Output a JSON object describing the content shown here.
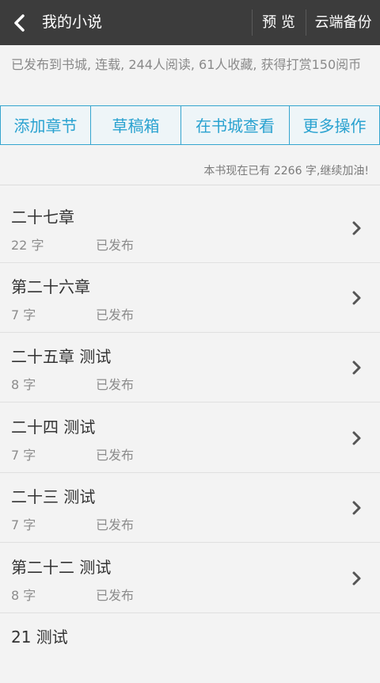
{
  "header": {
    "title": "我的小说",
    "preview_label": "预 览",
    "backup_label": "云端备份"
  },
  "info": {
    "summary": "已发布到书城, 连载, 244人阅读, 61人收藏, 获得打赏150阅币"
  },
  "actions": [
    {
      "label": "添加章节"
    },
    {
      "label": "草稿箱"
    },
    {
      "label": "在书城查看"
    },
    {
      "label": "更多操作"
    }
  ],
  "notice": "本书现在已有 2266 字,继续加油!",
  "chapters": [
    {
      "name": "二十七章",
      "count": "22 字",
      "status": "已发布"
    },
    {
      "name": "第二十六章",
      "count": "7 字",
      "status": "已发布"
    },
    {
      "name": "二十五章 测试",
      "count": "8 字",
      "status": "已发布"
    },
    {
      "name": "二十四 测试",
      "count": "7 字",
      "status": "已发布"
    },
    {
      "name": "二十三 测试",
      "count": "7 字",
      "status": "已发布"
    },
    {
      "name": "第二十二 测试",
      "count": "8 字",
      "status": "已发布"
    },
    {
      "name": "21 测试",
      "count": "",
      "status": ""
    }
  ],
  "colors": {
    "topbar": "#3c3c3c",
    "accent": "#2aa2d0",
    "background": "#f3f3f3"
  },
  "icons": {
    "back": "back-arrow-icon",
    "row": "chevron-right-icon"
  }
}
